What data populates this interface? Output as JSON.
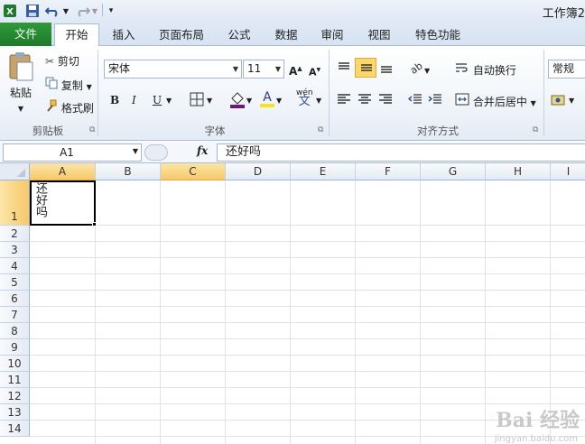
{
  "window": {
    "title": "工作簿2"
  },
  "tabs": [
    "文件",
    "开始",
    "插入",
    "页面布局",
    "公式",
    "数据",
    "审阅",
    "视图",
    "特色功能"
  ],
  "clipboard": {
    "paste": "粘贴",
    "cut": "剪切",
    "copy": "复制",
    "format_painter": "格式刷",
    "group": "剪贴板"
  },
  "font": {
    "name": "宋体",
    "size": "11",
    "bold": "B",
    "italic": "I",
    "underline": "U",
    "wen": "wén",
    "group": "字体"
  },
  "alignment": {
    "wrap": "自动换行",
    "merge": "合并后居中",
    "group": "对齐方式"
  },
  "number": {
    "format": "常规"
  },
  "formula_bar": {
    "name_box": "A1",
    "fx": "fx",
    "content": "还好吗"
  },
  "sheet": {
    "columns": [
      "A",
      "B",
      "C",
      "D",
      "E",
      "F",
      "G",
      "H",
      "I"
    ],
    "rows": [
      "1",
      "2",
      "3",
      "4",
      "5",
      "6",
      "7",
      "8",
      "9",
      "10",
      "11",
      "12",
      "13",
      "14"
    ],
    "a1": "还好吗"
  },
  "watermark": {
    "main": "Bai 经验",
    "sub": "jingyan.baidu.com"
  },
  "colors": {
    "file_tab": "#1e7a2a",
    "selected_header": "#f7c96a",
    "accent": "#2b579a"
  }
}
